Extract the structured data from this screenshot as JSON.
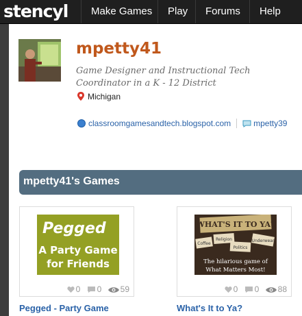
{
  "header": {
    "logo": "stencyl",
    "nav": [
      {
        "label": "Make Games"
      },
      {
        "label": "Play"
      },
      {
        "label": "Forums"
      },
      {
        "label": "Help"
      }
    ]
  },
  "profile": {
    "username": "mpetty41",
    "bio": "Game Designer and Instructional Tech Coordinator in a K - 12 District",
    "location": "Michigan",
    "website": "classroomgamesandtech.blogspot.com",
    "chat_handle": "mpetty39"
  },
  "games_section": {
    "title": "mpetty41's Games",
    "games": [
      {
        "title": "Pegged - Party Game",
        "thumb_lines": [
          "Pegged",
          "A Party Game",
          "for Friends"
        ],
        "likes": "0",
        "comments": "0",
        "views": "59"
      },
      {
        "title": "What's It to Ya?",
        "thumb_lines": [
          "WHAT'S IT TO YA?",
          "Coffee",
          "Religion",
          "Politics",
          "Underwear",
          "The hilarious game of",
          "What Matters Most!"
        ],
        "likes": "0",
        "comments": "0",
        "views": "88"
      }
    ]
  },
  "colors": {
    "topbar": "#1f1f1f",
    "username": "#c0581c",
    "link": "#2a62a8",
    "section_bar": "#536d80",
    "pegged_bg": "#8e9a1e"
  }
}
